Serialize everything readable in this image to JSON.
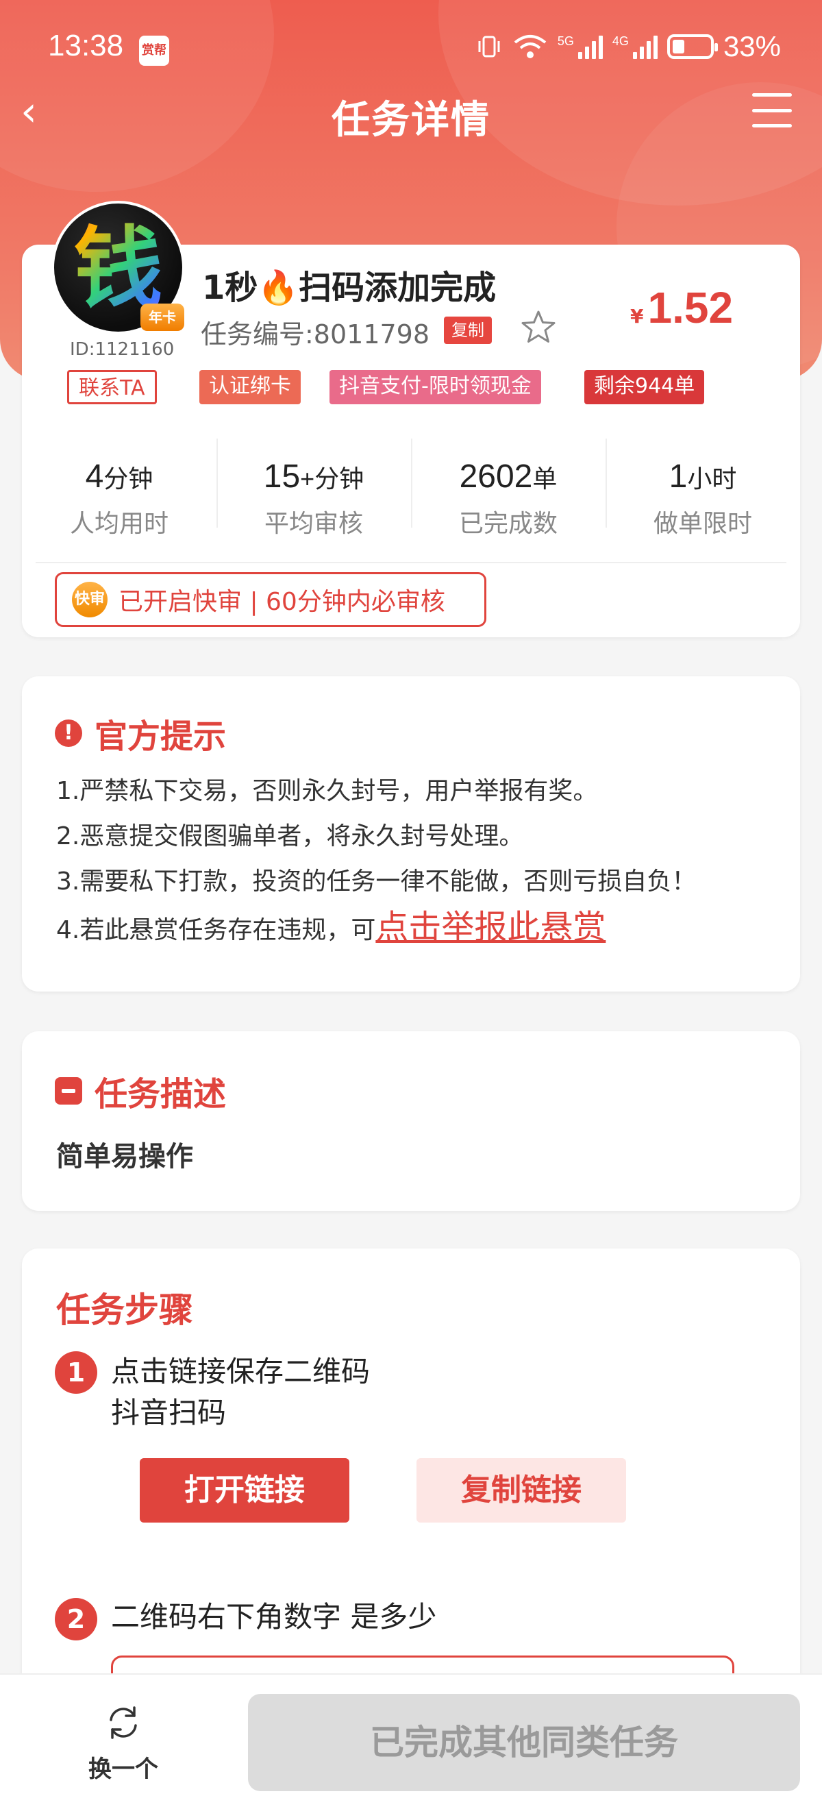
{
  "status_bar": {
    "time": "13:38",
    "app_badge": "赏帮",
    "net_5g": "5G",
    "net_4g": "4G",
    "battery": "33%",
    "battery_level": 0.33
  },
  "nav": {
    "back": "‹",
    "title": "任务详情"
  },
  "task": {
    "avatar_char": "钱",
    "year_badge": "年卡",
    "uid": "ID:1121160",
    "title": "1秒🔥扫码添加完成",
    "task_no": "任务编号:8011798",
    "copy_label": "复制",
    "price_currency": "¥",
    "price": "1.52",
    "tags": {
      "contact": "联系TA",
      "bind": "认证绑卡",
      "pay": "抖音支付-限时领现金",
      "left": "剩余944单"
    },
    "stats": [
      {
        "value": "4",
        "unit": "分钟",
        "label": "人均用时"
      },
      {
        "value": "15",
        "unit": "+分钟",
        "label": "平均审核"
      },
      {
        "value": "2602",
        "unit": "单",
        "label": "已完成数"
      },
      {
        "value": "1",
        "unit": "小时",
        "label": "做单限时"
      }
    ],
    "fast_icon": "快审",
    "fast_text": "已开启快审 | 60分钟内必审核"
  },
  "notice": {
    "title": "官方提示",
    "items": [
      "1.严禁私下交易，否则永久封号，用户举报有奖。",
      "2.恶意提交假图骗单者，将永久封号处理。",
      "3.需要私下打款，投资的任务一律不能做，否则亏损自负！"
    ],
    "item4_prefix": "4.若此悬赏任务存在违规，可",
    "report_link": "点击举报此悬赏"
  },
  "description": {
    "title": "任务描述",
    "text": "简单易操作"
  },
  "steps": {
    "title": "任务步骤",
    "step1_num": "1",
    "step1_line1": "点击链接保存二维码",
    "step1_line2": "抖音扫码",
    "open_link": "打开链接",
    "copy_link": "复制链接",
    "step2_num": "2",
    "step2_text": "二维码右下角数字 是多少"
  },
  "bottom": {
    "swap_label": "换一个",
    "done_label": "已完成其他同类任务"
  },
  "colors": {
    "accent": "#e0443d",
    "header": "#ee5d4f"
  }
}
